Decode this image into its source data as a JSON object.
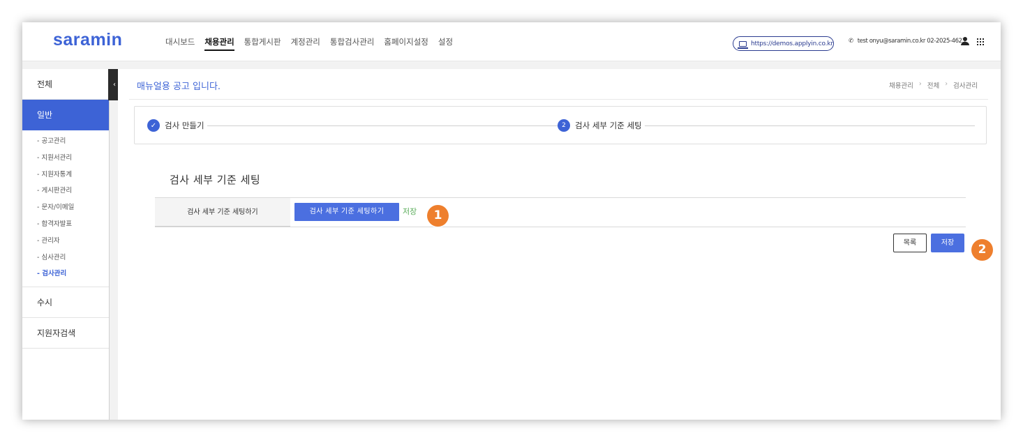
{
  "header": {
    "logo": "saramin",
    "nav": [
      "대시보드",
      "채용관리",
      "통합게시판",
      "계정관리",
      "통합검사관리",
      "홈페이지설정",
      "설정"
    ],
    "active_nav": 1,
    "url": "https://demos.applyin.co.kr",
    "contact": "test onyu@saramin.co.kr 02-2025-4623"
  },
  "sidebar": {
    "all": "전체",
    "general": "일반",
    "sub_items": [
      "- 공고관리",
      "- 지원서관리",
      "- 지원자통계",
      "- 게시판관리",
      "- 문자/이메일",
      "- 합격자발표",
      "- 관리자",
      "- 심사관리",
      "- 검사관리"
    ],
    "active_sub": 8,
    "occasional": "수시",
    "applicant_search": "지원자검색",
    "collapse": "‹"
  },
  "content": {
    "page_title": "매뉴얼용 공고 입니다.",
    "breadcrumb": [
      "채용관리",
      "전체",
      "검사관리"
    ],
    "steps": [
      {
        "label": "검사 만들기",
        "status": "done"
      },
      {
        "number": "2",
        "label": "검사 세부 기준 세팅",
        "status": "current"
      }
    ],
    "section_title": "검사 세부 기준 세팅",
    "form_label": "검사 세부 기준 세팅하기",
    "setting_button": "검사 세부 기준 세팅하기",
    "saved_status": "저장",
    "list_button": "목록",
    "save_button": "저장"
  },
  "annotations": [
    "1",
    "2"
  ],
  "colors": {
    "brand": "#3d63d6",
    "button": "#4b6fe0",
    "success": "#5aad5a",
    "annotation": "#ee7f2d"
  }
}
